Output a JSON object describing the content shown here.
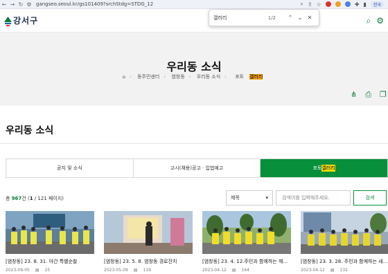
{
  "browser": {
    "url": "gangseo.seoul.kr/gs101409?srchStdg=STDG_12",
    "profile_label": "한국"
  },
  "findbar": {
    "query": "갤러리",
    "count": "1/2"
  },
  "header": {
    "logo_text": "강서구"
  },
  "hero": {
    "title": "우리동 소식",
    "crumbs": [
      "동주민센터",
      "염창동",
      "우리동 소식"
    ],
    "crumb_last_prefix": "포토",
    "crumb_last_highlight": "갤러리"
  },
  "section": {
    "title": "우리동 소식"
  },
  "tabs": [
    {
      "label": "공지 및 소식"
    },
    {
      "label": "고시(채용)공고 · 입법예고"
    },
    {
      "label_prefix": "포토",
      "label_highlight": "갤러리"
    }
  ],
  "listing": {
    "total_prefix": "총",
    "total_count": "967",
    "total_suffix": "건 (",
    "page_current": "1",
    "page_rest": " / 121 페이지)"
  },
  "search": {
    "select_value": "제목",
    "placeholder": "검색어를 입력해주세요.",
    "button_label": "검색"
  },
  "cards": [
    {
      "title": "[염창동] 23. 8. 31. 야간 특별순찰",
      "date": "2023-09-05",
      "views": "25"
    },
    {
      "title": "[염창동] 23. 5. 8. 염창동 경로잔치",
      "date": "2023-05-09",
      "views": "119"
    },
    {
      "title": "[염창동] 23. 4. 12.주민과 함께하는 깨...",
      "date": "2023-04-12",
      "views": "164"
    },
    {
      "title": "[염창동] 23. 3. 28. 주민과 함께하는 새...",
      "date": "2023-04-12",
      "views": "132"
    }
  ],
  "colors": {
    "accent": "#078f3b",
    "find_highlight_active": "#f5a000",
    "find_highlight": "#f6e000"
  }
}
